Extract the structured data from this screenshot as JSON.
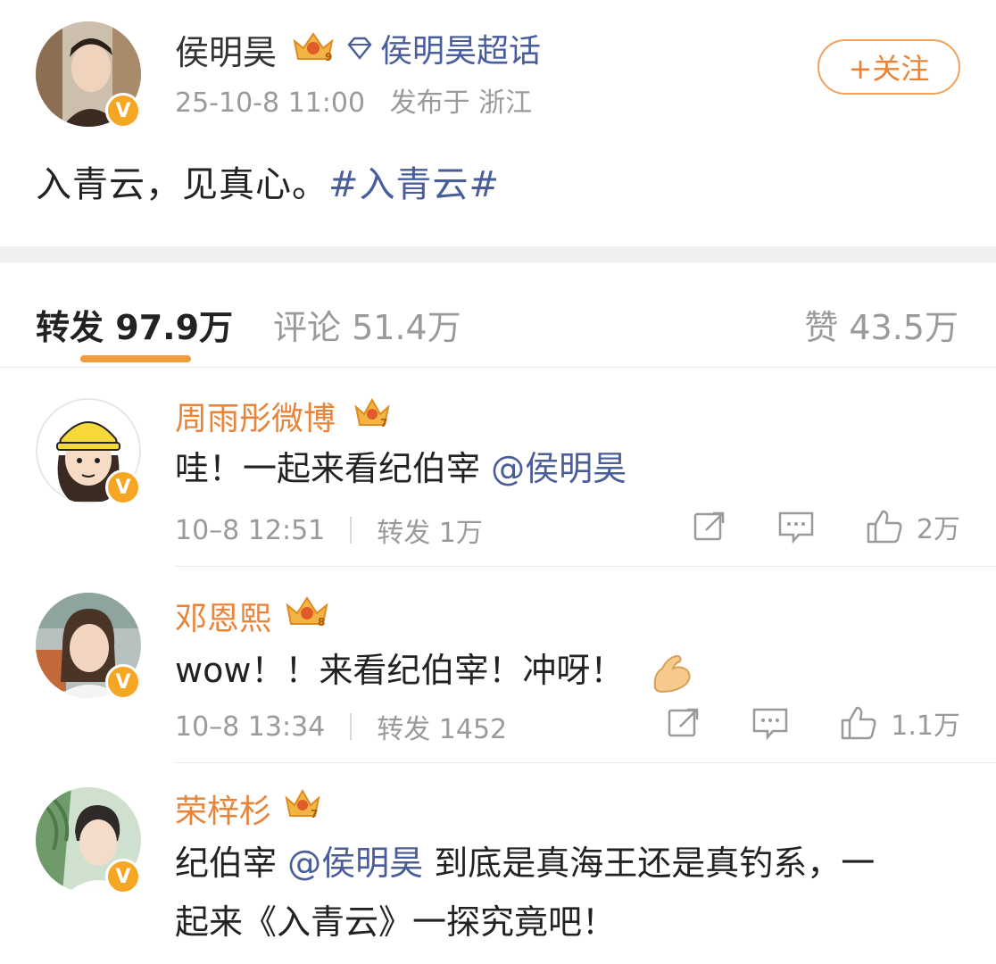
{
  "post": {
    "author": "侯明昊",
    "supertopic": "侯明昊超话",
    "time": "25-10-8 11:00",
    "location": "发布于 浙江",
    "follow_label": "+关注",
    "text_plain": "入青云，见真心。",
    "hashtag": "#入青云#",
    "crown_level": "9"
  },
  "tabs": {
    "reposts_label": "转发",
    "reposts_count": "97.9万",
    "comments_label": "评论",
    "comments_count": "51.4万",
    "likes_label": "赞",
    "likes_count": "43.5万"
  },
  "reposts": [
    {
      "name": "周雨彤微博",
      "crown_level": "7",
      "text_before": "哇！一起来看纪伯宰 ",
      "mention": "@侯明昊",
      "text_after": "",
      "time": "10–8 12:51",
      "repost_label": "转发 1万",
      "likes": "2万"
    },
    {
      "name": "邓恩熙",
      "crown_level": "8",
      "text_before": "wow！！来看纪伯宰！冲呀！",
      "mention": "",
      "text_after": "",
      "time": "10–8 13:34",
      "repost_label": "转发 1452",
      "likes": "1.1万"
    },
    {
      "name": "荣梓杉",
      "crown_level": "7",
      "text_before": "纪伯宰 ",
      "mention": "@侯明昊",
      "text_after": " 到底是真海王还是真钓系，一",
      "text_line2": "起来《入青云》一探究竟吧！"
    }
  ],
  "icons": {
    "verified": "verified-v-badge",
    "crown": "crown-icon",
    "supertopic": "diamond-icon",
    "repost": "share-icon",
    "comment": "comment-icon",
    "like": "thumbs-up-icon"
  },
  "colors": {
    "accent": "#e8843a",
    "link": "#4a5d9b",
    "muted": "#9a9a9a",
    "verified": "#f5a623"
  }
}
